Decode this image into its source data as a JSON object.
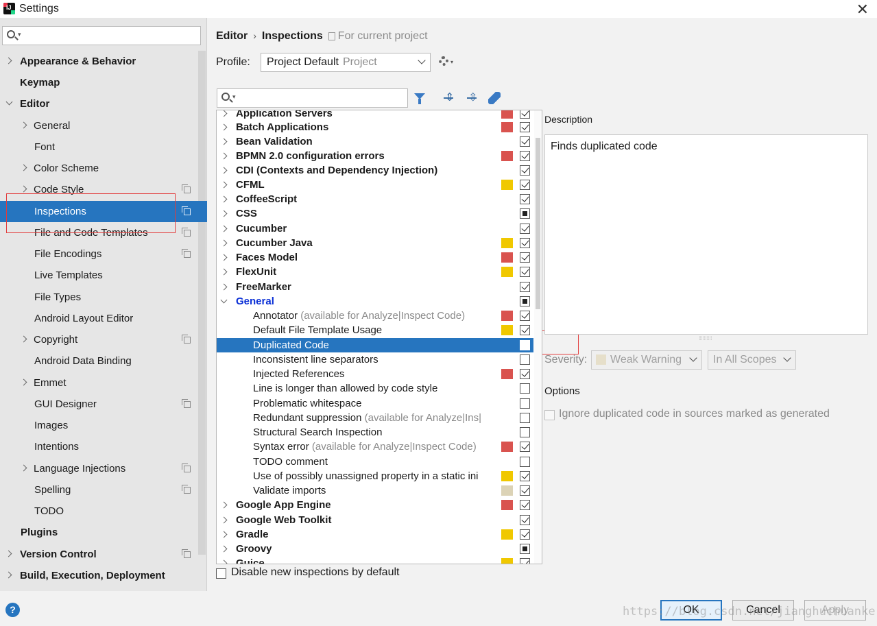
{
  "window": {
    "title": "Settings",
    "close": "✕"
  },
  "sidebar": {
    "search_placeholder": "",
    "items": [
      {
        "label": "Appearance & Behavior"
      },
      {
        "label": "Keymap"
      },
      {
        "label": "Editor"
      },
      {
        "label": "General"
      },
      {
        "label": "Font"
      },
      {
        "label": "Color Scheme"
      },
      {
        "label": "Code Style"
      },
      {
        "label": "Inspections"
      },
      {
        "label": "File and Code Templates"
      },
      {
        "label": "File Encodings"
      },
      {
        "label": "Live Templates"
      },
      {
        "label": "File Types"
      },
      {
        "label": "Android Layout Editor"
      },
      {
        "label": "Copyright"
      },
      {
        "label": "Android Data Binding"
      },
      {
        "label": "Emmet"
      },
      {
        "label": "GUI Designer"
      },
      {
        "label": "Images"
      },
      {
        "label": "Intentions"
      },
      {
        "label": "Language Injections"
      },
      {
        "label": "Spelling"
      },
      {
        "label": "TODO"
      },
      {
        "label": "Plugins"
      },
      {
        "label": "Version Control"
      },
      {
        "label": "Build, Execution, Deployment"
      }
    ]
  },
  "breadcrumb": {
    "parent": "Editor",
    "sep": "›",
    "current": "Inspections",
    "scope": "For current project"
  },
  "profile": {
    "label": "Profile:",
    "value": "Project Default",
    "sub": "Project"
  },
  "inspections": {
    "search_placeholder": "",
    "rows": [
      {
        "name": "Application Servers",
        "hint": ""
      },
      {
        "name": "Batch Applications",
        "hint": ""
      },
      {
        "name": "Bean Validation",
        "hint": ""
      },
      {
        "name": "BPMN 2.0 configuration errors",
        "hint": ""
      },
      {
        "name": "CDI (Contexts and Dependency Injection)",
        "hint": ""
      },
      {
        "name": "CFML",
        "hint": ""
      },
      {
        "name": "CoffeeScript",
        "hint": ""
      },
      {
        "name": "CSS",
        "hint": ""
      },
      {
        "name": "Cucumber",
        "hint": ""
      },
      {
        "name": "Cucumber Java",
        "hint": ""
      },
      {
        "name": "Faces Model",
        "hint": ""
      },
      {
        "name": "FlexUnit",
        "hint": ""
      },
      {
        "name": "FreeMarker",
        "hint": ""
      },
      {
        "name": "General",
        "hint": ""
      },
      {
        "name": "Annotator",
        "hint": "(available for Analyze|Inspect Code)"
      },
      {
        "name": "Default File Template Usage",
        "hint": ""
      },
      {
        "name": "Duplicated Code",
        "hint": ""
      },
      {
        "name": "Inconsistent line separators",
        "hint": ""
      },
      {
        "name": "Injected References",
        "hint": ""
      },
      {
        "name": "Line is longer than allowed by code style",
        "hint": ""
      },
      {
        "name": "Problematic whitespace",
        "hint": ""
      },
      {
        "name": "Redundant suppression",
        "hint": "(available for Analyze|Ins|"
      },
      {
        "name": "Structural Search Inspection",
        "hint": ""
      },
      {
        "name": "Syntax error",
        "hint": "(available for Analyze|Inspect Code)"
      },
      {
        "name": "TODO comment",
        "hint": ""
      },
      {
        "name": "Use of possibly unassigned property in a static ini",
        "hint": ""
      },
      {
        "name": "Validate imports",
        "hint": ""
      },
      {
        "name": "Google App Engine",
        "hint": ""
      },
      {
        "name": "Google Web Toolkit",
        "hint": ""
      },
      {
        "name": "Gradle",
        "hint": ""
      },
      {
        "name": "Groovy",
        "hint": ""
      },
      {
        "name": "Guice",
        "hint": ""
      }
    ],
    "disable_new_label": "Disable new inspections by default"
  },
  "details": {
    "description_label": "Description",
    "description_text": "Finds duplicated code",
    "severity_label": "Severity:",
    "severity_value": "Weak Warning",
    "scope_value": "In All Scopes",
    "options_label": "Options",
    "option_ignore_generated": "Ignore duplicated code in sources marked as generated"
  },
  "buttons": {
    "help": "?",
    "ok": "OK",
    "cancel": "Cancel",
    "apply": "Apply"
  },
  "watermark": "https://blog.csdn.net/jianghuchuanke",
  "colors": {
    "selection": "#2675bf",
    "severity_error": "#d9534f",
    "severity_warning": "#f0c800",
    "severity_weak": "#dcd3b6"
  }
}
